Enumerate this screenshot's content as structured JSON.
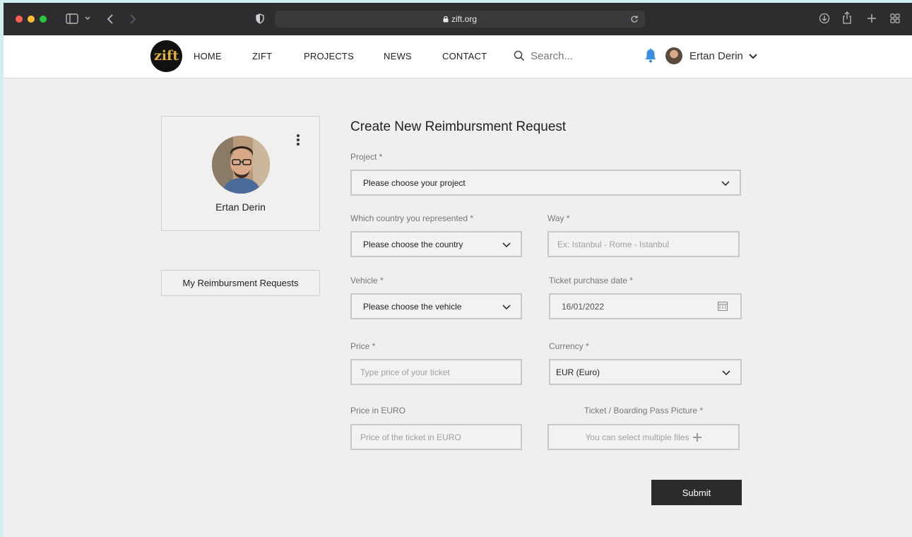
{
  "browser": {
    "url": "zift.org"
  },
  "site": {
    "logo_text": "zift",
    "nav": [
      "HOME",
      "ZIFT",
      "PROJECTS",
      "NEWS",
      "CONTACT"
    ],
    "search_placeholder": "Search...",
    "user_name": "Ertan Derin"
  },
  "profile": {
    "name": "Ertan Derin",
    "my_requests_label": "My Reimbursment Requests"
  },
  "form": {
    "title": "Create New Reimbursment Request",
    "project": {
      "label": "Project *",
      "value": "Please choose your project"
    },
    "country": {
      "label": "Which country you represented *",
      "value": "Please choose the country"
    },
    "way": {
      "label": "Way *",
      "placeholder": "Ex: Istanbul - Rome - Istanbul"
    },
    "vehicle": {
      "label": "Vehicle *",
      "value": "Please choose the vehicle"
    },
    "ticket_date": {
      "label": "Ticket purchase date *",
      "value": "16/01/2022"
    },
    "price": {
      "label": "Price *",
      "placeholder": "Type price of your ticket"
    },
    "currency": {
      "label": "Currency *",
      "value": "EUR (Euro)"
    },
    "price_euro": {
      "label": "Price in EURO",
      "placeholder": "Price of the ticket in EURO"
    },
    "ticket_picture": {
      "label": "Ticket / Boarding Pass Picture *",
      "placeholder": "You can select multiple files"
    },
    "submit_label": "Submit"
  },
  "colors": {
    "accent_bell": "#3b8fe3",
    "submit_bg": "#2b2b2b",
    "page_bg": "#efefef"
  }
}
